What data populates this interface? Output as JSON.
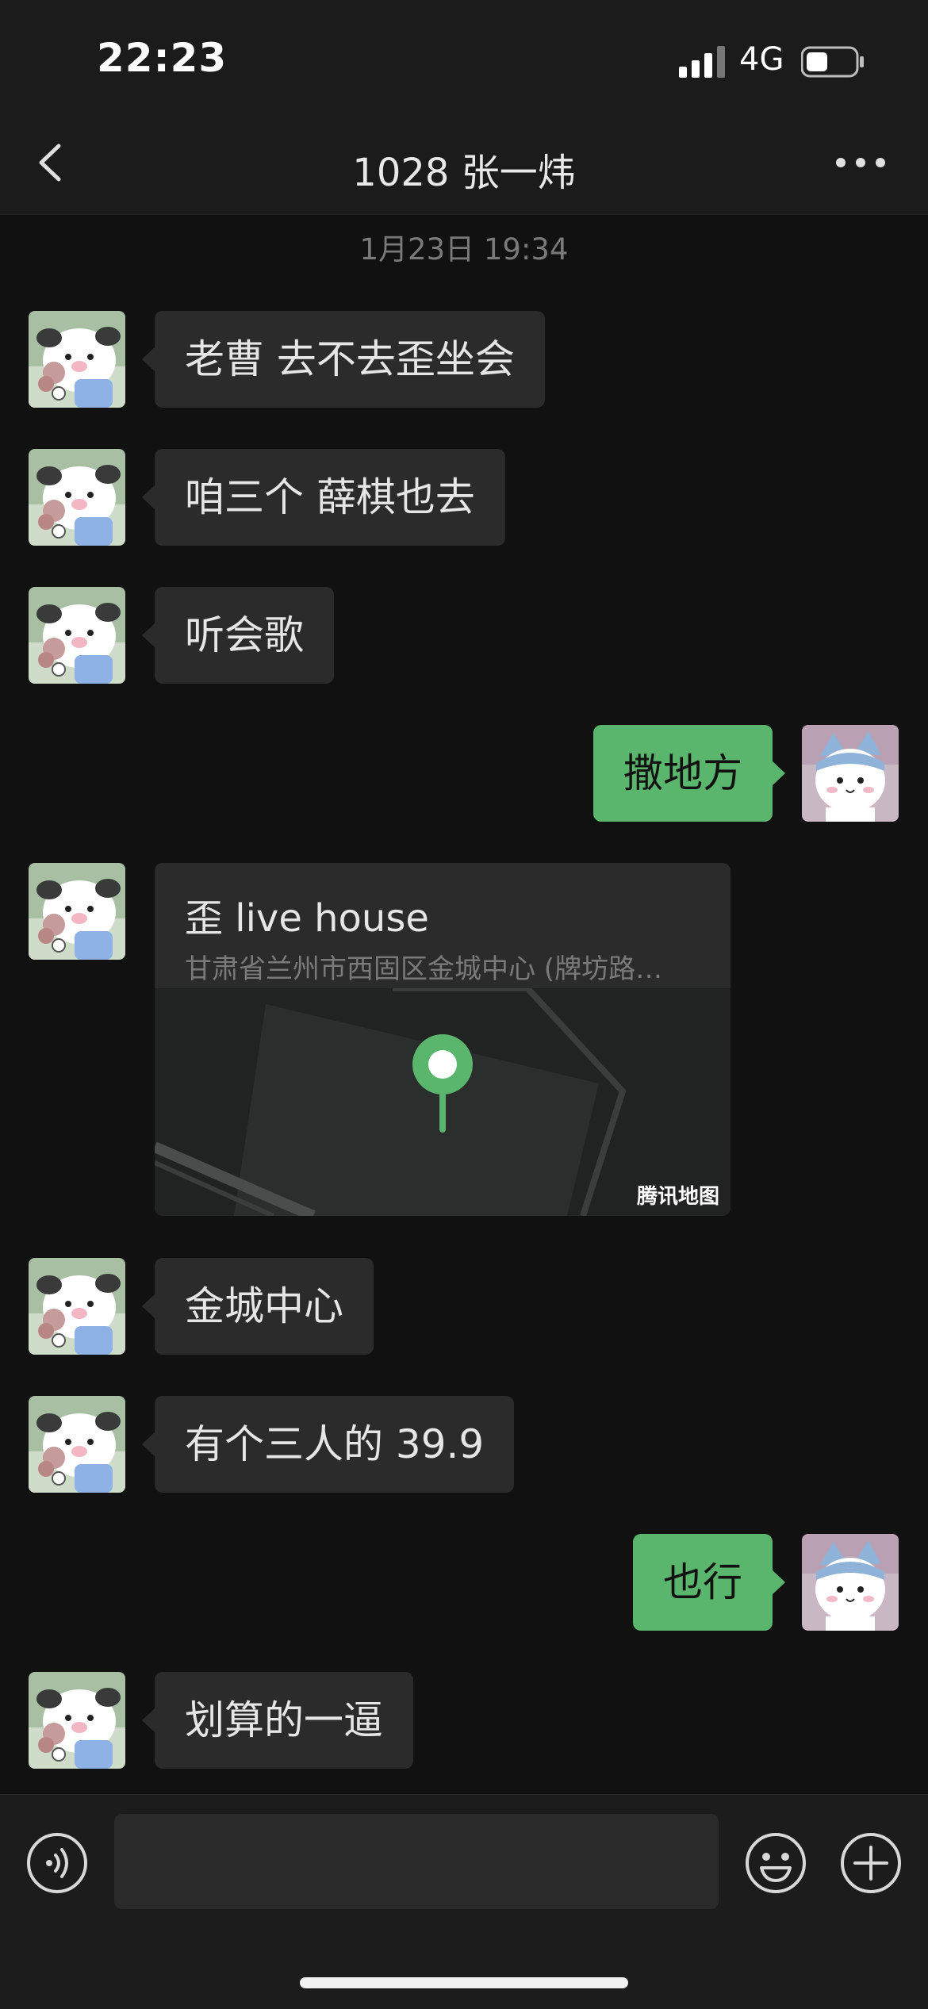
{
  "status_bar": {
    "time": "22:23",
    "network": "4G",
    "battery_level": 0.45
  },
  "nav": {
    "title": "1028 张一炜",
    "back_icon": "chevron-left-icon",
    "more_icon": "more-dots-icon"
  },
  "timestamp": "1月23日 19:34",
  "messages": [
    {
      "side": "in",
      "text": "老曹 去不去歪坐会"
    },
    {
      "side": "in",
      "text": "咱三个 薛棋也去"
    },
    {
      "side": "in",
      "text": "听会歌"
    },
    {
      "side": "out",
      "text": "撒地方"
    },
    {
      "side": "in",
      "type": "location",
      "name": "歪 live house",
      "address": "甘肃省兰州市西固区金城中心 (牌坊路…",
      "map_label": "腾讯地图"
    },
    {
      "side": "in",
      "text": "金城中心"
    },
    {
      "side": "in",
      "text": "有个三人的 39.9"
    },
    {
      "side": "out",
      "text": "也行"
    },
    {
      "side": "in",
      "text": "划算的一逼"
    }
  ],
  "input_bar": {
    "voice_icon": "voice-icon",
    "emoji_icon": "emoji-icon",
    "plus_icon": "plus-icon"
  },
  "colors": {
    "background": "#111111",
    "bubble_in": "#2b2b2b",
    "bubble_out": "#5ab66c",
    "map_pin": "#5ab66c"
  }
}
